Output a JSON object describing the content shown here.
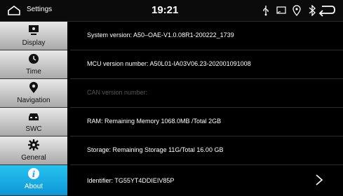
{
  "statusbar": {
    "title": "Settings",
    "time": "19:21",
    "icons": [
      "usb-icon",
      "screen-mirror-icon",
      "location-icon",
      "bluetooth-icon"
    ]
  },
  "sidebar": {
    "items": [
      {
        "label": "Display",
        "icon": "display-icon"
      },
      {
        "label": "Time",
        "icon": "clock-icon"
      },
      {
        "label": "Navigation",
        "icon": "location-pin-icon"
      },
      {
        "label": "SWC",
        "icon": "steering-wheel-control-icon"
      },
      {
        "label": "General",
        "icon": "gear-icon"
      },
      {
        "label": "About",
        "icon": "info-icon",
        "active": true
      }
    ]
  },
  "about": {
    "system_version": "System version:  A50–OAE-V1.0.08R1-200222_1739",
    "mcu_version": "MCU version number:   A50L01-IA03V06.23-202001091008",
    "can_version": "CAN version number:",
    "ram": "RAM:   Remaining Memory 1068.0MB /Total 2GB",
    "storage": "Storage:   Remaining Storage 11G/Total  16.00 GB",
    "identifier": "Identifier:   TG55YT4DDIEIV85P"
  },
  "colors": {
    "accent": "#1ea9e1",
    "background": "#000000",
    "sidebar_inactive": "#c8c8c8"
  }
}
